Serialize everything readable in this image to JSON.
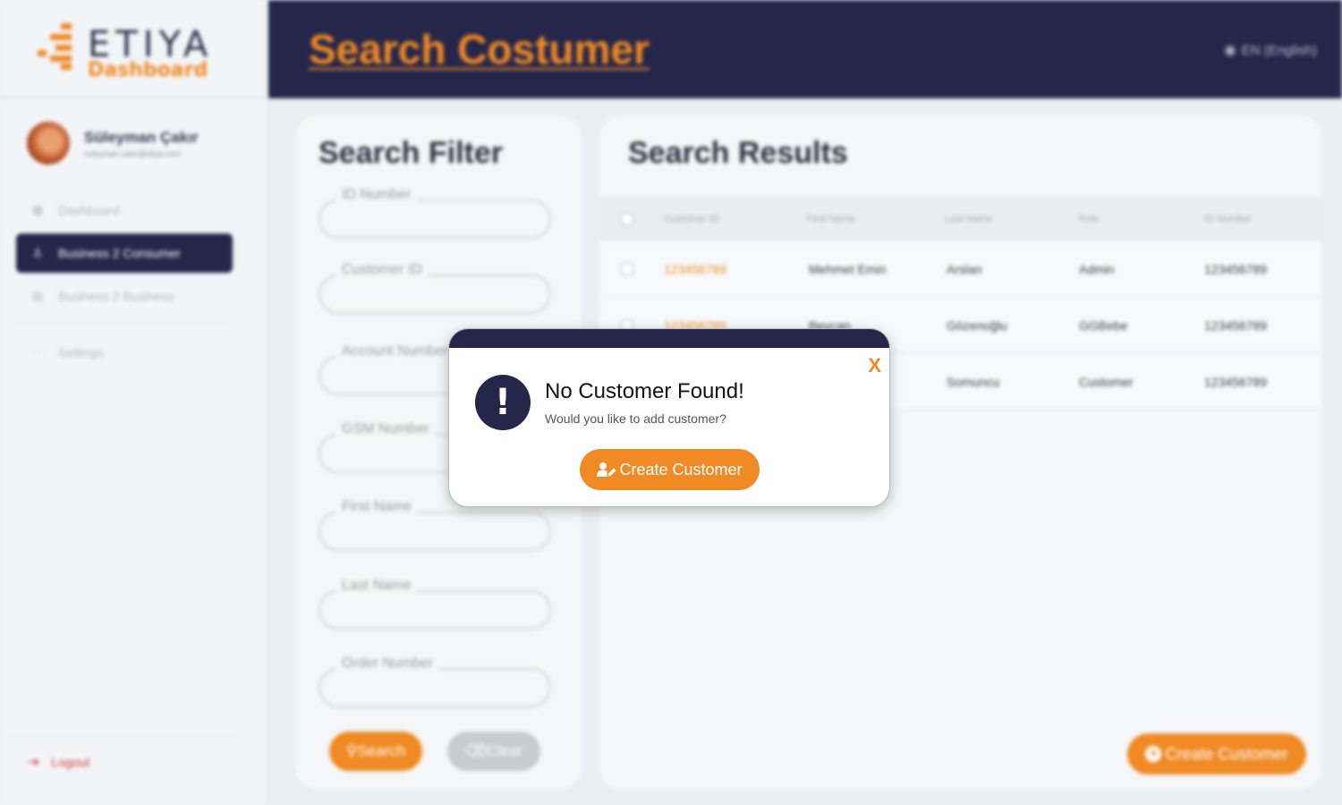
{
  "brand": {
    "name": "ETIYA",
    "sub": "Dashboard"
  },
  "user": {
    "name": "Süleyman Çakır",
    "email": "suleyman.cakir@etiya.com"
  },
  "sidebar": {
    "items": [
      {
        "label": "Dashboard",
        "icon": "grid-icon",
        "active": false
      },
      {
        "label": "Business 2 Consumer",
        "icon": "person-icon",
        "active": true
      },
      {
        "label": "Business 2 Business",
        "icon": "calendar-icon",
        "active": false
      }
    ],
    "settings": "Settings",
    "logout": "Logout"
  },
  "header": {
    "title": "Search Costumer",
    "language": "EN (English)"
  },
  "filter": {
    "title": "Search Filter",
    "fields": [
      "ID Number",
      "Customer ID",
      "Account Number",
      "GSM Number",
      "First Name",
      "Last Name",
      "Order Number"
    ],
    "search_label": "Search",
    "clear_label": "Clear"
  },
  "results": {
    "title": "Search Results",
    "columns": [
      "Customer ID",
      "First Name",
      "Last Name",
      "Role",
      "ID Number"
    ],
    "rows": [
      [
        "123456789",
        "Mehmet Emin",
        "Arslan",
        "Admin",
        "123456789"
      ],
      [
        "123456789",
        "Beycan",
        "Gözenoğlu",
        "GGBebe",
        "123456789"
      ],
      [
        "",
        "",
        "Somuncu",
        "Customer",
        "123456789"
      ]
    ],
    "create_label": "Create Customer"
  },
  "modal": {
    "title": "No Customer Found!",
    "message": "Would you like to add customer?",
    "button_label": "Create Customer",
    "close_label": "X"
  },
  "colors": {
    "accent": "#f08a24",
    "navy": "#25264a"
  }
}
